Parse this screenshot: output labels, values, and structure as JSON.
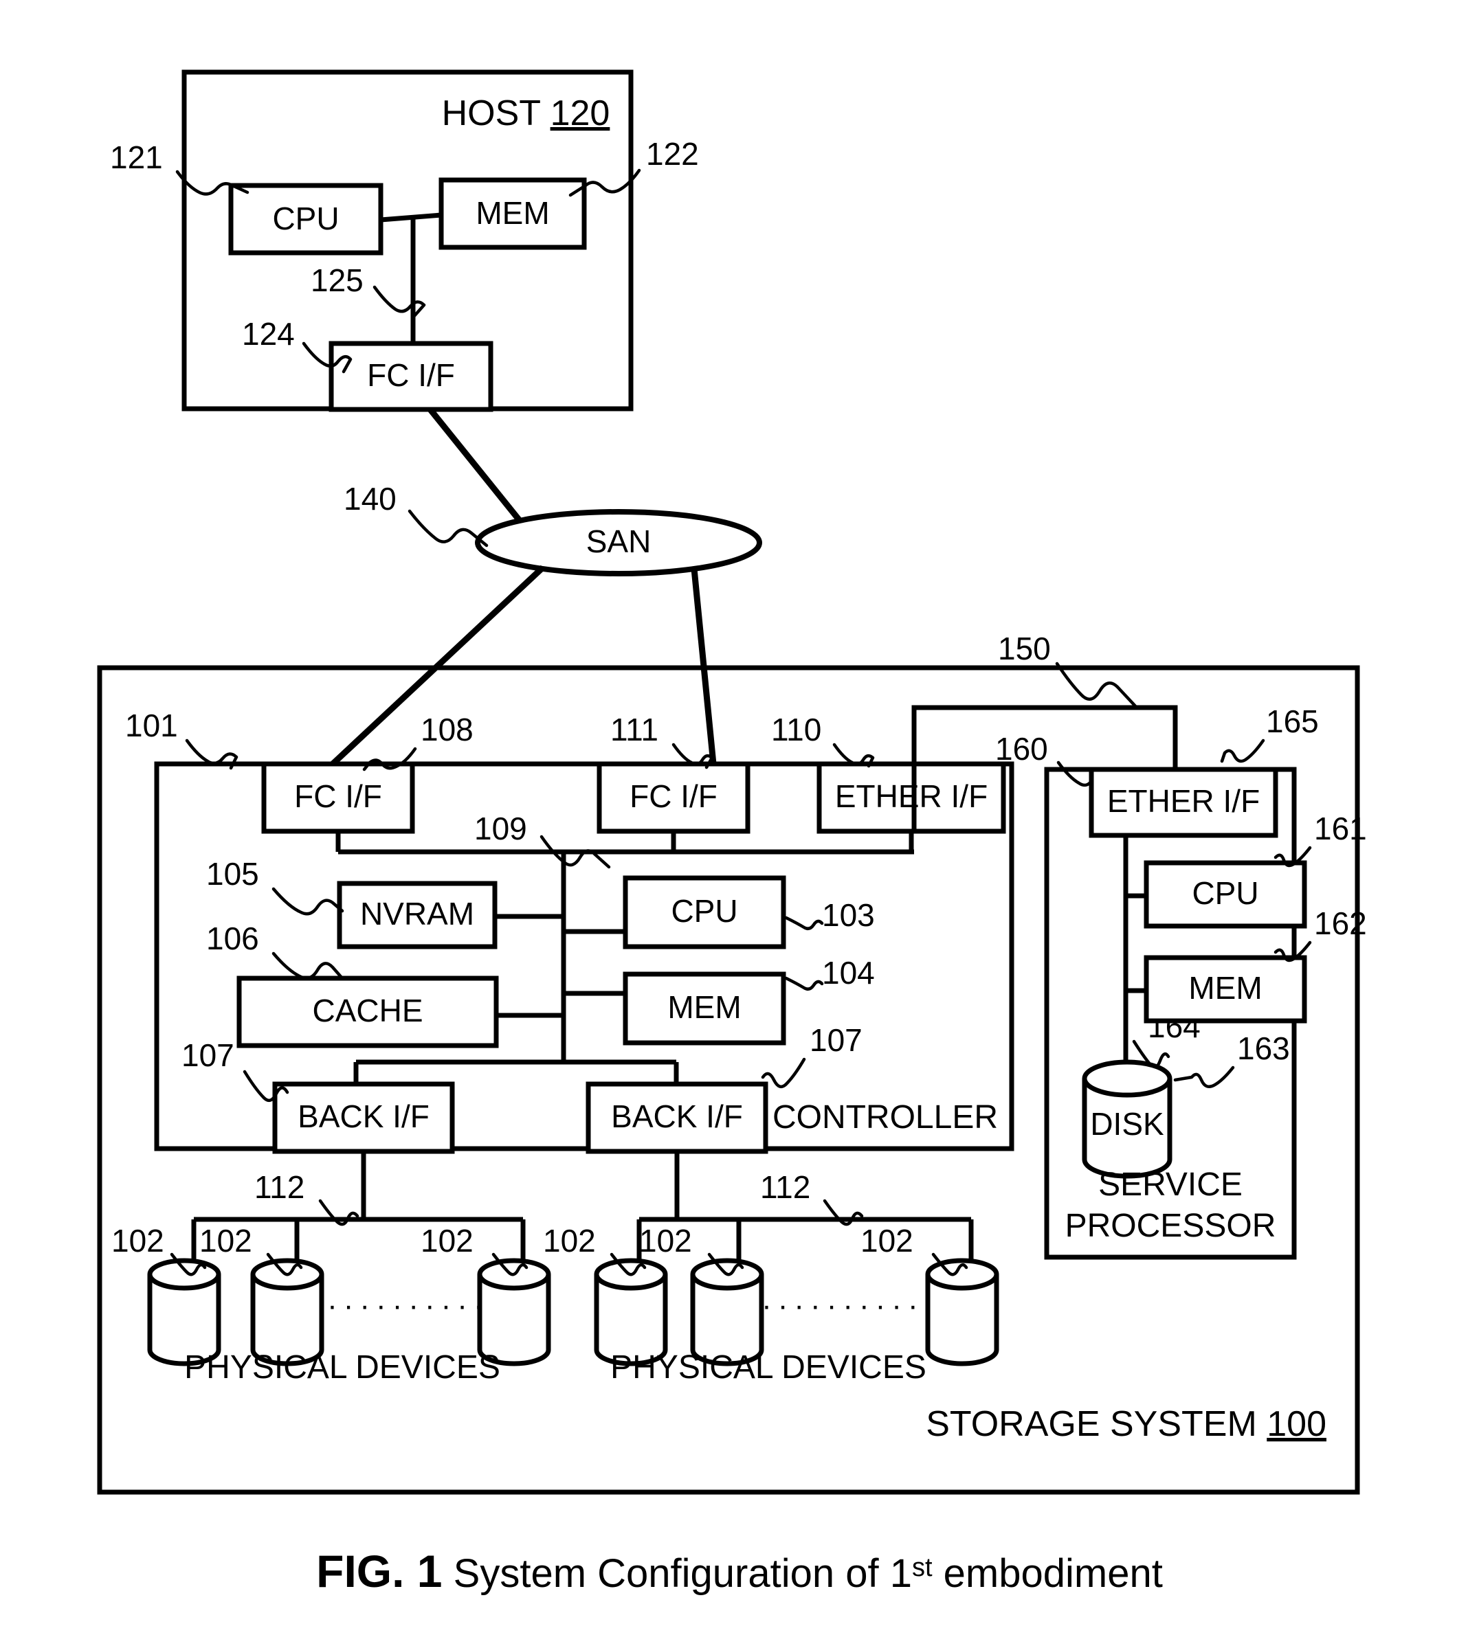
{
  "figure": {
    "caption_bold": "FIG. 1",
    "caption_rest": "System Configuration of 1",
    "caption_sup": "st",
    "caption_tail": " embodiment"
  },
  "host": {
    "title": "HOST",
    "ref": "120",
    "cpu": {
      "label": "CPU",
      "ref": "121"
    },
    "mem": {
      "label": "MEM",
      "ref": "122"
    },
    "fc_if": {
      "label": "FC I/F",
      "ref": "124"
    },
    "bus_ref": "125"
  },
  "san": {
    "label": "SAN",
    "ref": "140"
  },
  "storage": {
    "title": "STORAGE SYSTEM",
    "ref": "100",
    "controller": {
      "label": "CONTROLLER",
      "ref": "101",
      "fc_if_left": {
        "label": "FC I/F",
        "ref": "108"
      },
      "fc_if_right": {
        "label": "FC I/F",
        "ref": "111"
      },
      "ether_if": {
        "label": "ETHER I/F",
        "ref": "110"
      },
      "nvram": {
        "label": "NVRAM",
        "ref": "105"
      },
      "cache": {
        "label": "CACHE",
        "ref": "106"
      },
      "cpu": {
        "label": "CPU",
        "ref": "103"
      },
      "mem": {
        "label": "MEM",
        "ref": "104"
      },
      "bus_ref": "109",
      "back_if_left": {
        "label": "BACK I/F",
        "ref": "107"
      },
      "back_if_right": {
        "label": "BACK I/F",
        "ref": "107"
      }
    },
    "lan_ref": "150",
    "service_processor": {
      "label_line1": "SERVICE",
      "label_line2": "PROCESSOR",
      "ref": "160",
      "ether_if": {
        "label": "ETHER I/F",
        "ref": "165"
      },
      "cpu": {
        "label": "CPU",
        "ref": "161"
      },
      "mem": {
        "label": "MEM",
        "ref": "162"
      },
      "disk": {
        "label": "DISK",
        "ref": "163"
      },
      "bus_ref": "164"
    },
    "device_groups": [
      {
        "label": "PHYSICAL DEVICES",
        "bus_ref": "112",
        "device_refs": [
          "102",
          "102",
          "102"
        ],
        "ellipsis": "············"
      },
      {
        "label": "PHYSICAL DEVICES",
        "bus_ref": "112",
        "device_refs": [
          "102",
          "102",
          "102"
        ],
        "ellipsis": "············"
      }
    ]
  },
  "colors": {
    "ink": "#000000",
    "paper": "#ffffff"
  }
}
